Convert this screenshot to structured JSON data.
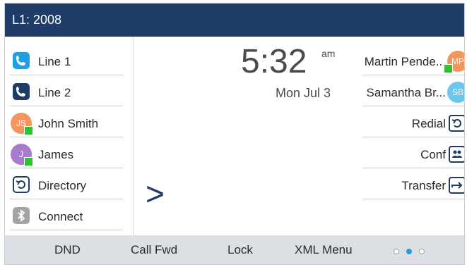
{
  "header": {
    "title": "L1: 2008"
  },
  "left_keys": [
    {
      "label": "Line 1",
      "icon": "phone-icon"
    },
    {
      "label": "Line 2",
      "icon": "phone-icon"
    },
    {
      "label": "John Smith",
      "initials": "JS",
      "color": "#f3955c",
      "status": "available"
    },
    {
      "label": "James",
      "initials": "J",
      "color": "#a779cf",
      "status": "available"
    },
    {
      "label": "Directory",
      "icon": "directory-icon"
    },
    {
      "label": "Connect",
      "icon": "bluetooth-icon"
    }
  ],
  "idle": {
    "time": "5:32",
    "ampm": "am",
    "date": "Mon Jul 3",
    "arrow": ">"
  },
  "right_keys": [
    {
      "label": "Martin Pende...",
      "initials": "MP",
      "color": "#f3955c",
      "status": "available"
    },
    {
      "label": "Samantha Br...",
      "initials": "SB",
      "color": "#6cc6ef"
    },
    {
      "label": "Redial",
      "icon": "redial-icon"
    },
    {
      "label": "Conf",
      "icon": "conference-icon"
    },
    {
      "label": "Transfer",
      "icon": "transfer-icon"
    }
  ],
  "softkeys": [
    "DND",
    "Call Fwd",
    "Lock",
    "XML Menu"
  ],
  "page_indicator": {
    "total": 3,
    "active": 2
  },
  "colors": {
    "header": "#1f3b68",
    "accent": "#1fa0e0",
    "presence": "#2fc12f"
  }
}
